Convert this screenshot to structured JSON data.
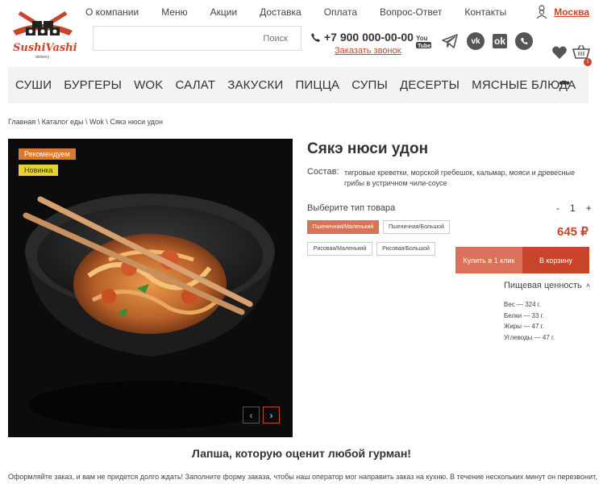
{
  "brand": {
    "name": "SushiVashi",
    "sub": "delivery"
  },
  "topnav": [
    "О компании",
    "Меню",
    "Акции",
    "Доставка",
    "Оплата",
    "Вопрос-Ответ",
    "Контакты"
  ],
  "city": "Москва",
  "search": {
    "placeholder": "Поиск"
  },
  "phone": "+7 900 000-00-00",
  "callback": "Заказать звонок",
  "socials": [
    "youtube-icon",
    "telegram-icon",
    "vk-icon",
    "odnoklassniki-icon",
    "whatsapp-icon"
  ],
  "cart": {
    "count": "1"
  },
  "categories": [
    "СУШИ",
    "БУРГЕРЫ",
    "WOK",
    "САЛАТ",
    "ЗАКУСКИ",
    "ПИЦЦА",
    "СУПЫ",
    "ДЕСЕРТЫ",
    "МЯСНЫЕ БЛЮДА"
  ],
  "more": "•••",
  "breadcrumb": "Главная \\ Каталог еды \\ Wok \\ Сякэ нюси удон",
  "badges": {
    "recommend": "Рекомендуем",
    "new": "Новинка"
  },
  "product": {
    "title": "Сякэ нюси удон",
    "composition_label": "Состав:",
    "composition": "тигровые креветки, морской гребешок, кальмар, мояси и древесные грибы в устричном чили-соусе",
    "type_label": "Выберите тип товара",
    "options": [
      "Пшеничная/Маленький",
      "Пшеничная/Большой",
      "Рисовая/Маленький",
      "Рисовая/Большой"
    ],
    "selected_option": "Пшеничная/Маленький",
    "qty": {
      "minus": "-",
      "value": "1",
      "plus": "+"
    },
    "price": "645 ₽",
    "buy_one_click": "Купить в 1 клик",
    "add_to_cart": "В корзину",
    "nutrition_title": "Пищевая ценность",
    "nutrition": [
      "Вес — 324 г.",
      "Белки — 33 г.",
      "Жиры — 47 г.",
      "Углеводы — 47 г."
    ]
  },
  "tagline": "Лапша, которую оценит любой гурман!",
  "description": "Оформляйте заказ, и вам не придется долго ждать! Заполните форму заказа, чтобы наш оператор мог направить заказ на кухню. В течение нескольких минут он перезвонит,",
  "colors": {
    "accent": "#c8442a",
    "accent_light": "#d97258",
    "badge_rec": "#d9782f",
    "badge_new": "#e6d330"
  }
}
